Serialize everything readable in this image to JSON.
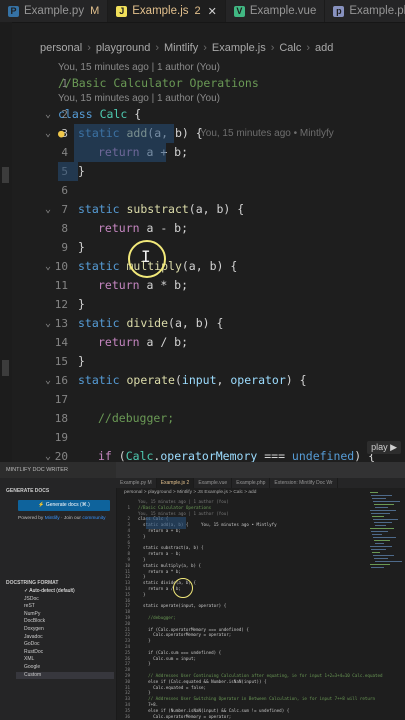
{
  "top_editor": {
    "tabs": [
      {
        "label": "Example.py",
        "badge": "M",
        "icon": "python-icon",
        "icon_color": "#3572A5"
      },
      {
        "label": "Example.js",
        "badge": "2",
        "icon": "javascript-icon",
        "icon_color": "#f1e05a",
        "active": true
      },
      {
        "label": "Example.vue",
        "badge": "",
        "icon": "vue-icon",
        "icon_color": "#41b883"
      },
      {
        "label": "Example.php",
        "badge": "",
        "icon": "php-icon",
        "icon_color": "#8892bf"
      }
    ],
    "breadcrumb": [
      "personal",
      "playground",
      "Mintlify",
      "Example.js",
      "Calc",
      "add"
    ],
    "author_notes": [
      "You, 15 minutes ago | 1 author (You)",
      "You, 15 minutes ago | 1 author (You)"
    ],
    "blame_inline": "You, 15 minutes ago • Mintlyfy",
    "lines": [
      {
        "n": "",
        "note": 0
      },
      {
        "n": "1",
        "text": "//Basic Calculator Operations"
      },
      {
        "n": "",
        "note": 1
      },
      {
        "n": "2",
        "text": "class Calc {"
      },
      {
        "n": "3",
        "text": "static add(a, b) {"
      },
      {
        "n": "4",
        "text": "return a + b;"
      },
      {
        "n": "5",
        "text": "}"
      },
      {
        "n": "6",
        "text": ""
      },
      {
        "n": "7",
        "text": "static substract(a, b) {"
      },
      {
        "n": "8",
        "text": "return a - b;"
      },
      {
        "n": "9",
        "text": "}"
      },
      {
        "n": "10",
        "text": "static multiply(a, b) {"
      },
      {
        "n": "11",
        "text": "return a * b;"
      },
      {
        "n": "12",
        "text": "}"
      },
      {
        "n": "13",
        "text": "static divide(a, b) {"
      },
      {
        "n": "14",
        "text": "return a / b;"
      },
      {
        "n": "15",
        "text": "}"
      },
      {
        "n": "16",
        "text": "static operate(input, operator) {"
      },
      {
        "n": "17",
        "text": ""
      },
      {
        "n": "18",
        "text": "//debugger;"
      },
      {
        "n": "19",
        "text": ""
      },
      {
        "n": "20",
        "text": "if (Calc.operatorMemory === undefined) {"
      },
      {
        "n": "21",
        "text": "Calc.operatorMemory = operator;"
      },
      {
        "n": "22",
        "text": "}"
      },
      {
        "n": "23",
        "text": ""
      },
      {
        "n": "24",
        "text": "if (Calc.sum === undefined) {"
      },
      {
        "n": "25",
        "text": "Calc.sum = input;"
      },
      {
        "n": "26",
        "text": ""
      },
      {
        "n": "27",
        "text": "}"
      },
      {
        "n": "28",
        "text": ""
      },
      {
        "n": "29",
        "text": "// Addresses User Continuing Calculation after equating, ie f"
      },
      {
        "n": "",
        "text": "14."
      },
      {
        "n": "30",
        "text": "else if (Calc.equated && Number.isNaN(input)) {"
      },
      {
        "n": "31",
        "text": "Calc.equated = false;"
      }
    ],
    "play_badge": "play ▶"
  },
  "bottom_window": {
    "sidebar_title": "MINTLIFY DOC WRITER",
    "generate_header": "GENERATE DOCS",
    "generate_button": "⚡ Generate docs (⌘.)",
    "powered_prefix": "Powered by",
    "powered_link1": "Mintlify",
    "powered_mid": "· Join our",
    "powered_link2": "community",
    "format_header": "DOCSTRING FORMAT",
    "formats": [
      "Auto-detect (default)",
      "JSDoc",
      "reST",
      "NumPy",
      "DocBlock",
      "Doxygen",
      "Javadoc",
      "GoDoc",
      "RustDoc",
      "XML",
      "Google",
      "Custom"
    ],
    "tabs": [
      "Example.py M",
      "Example.js 2",
      "Example.vue",
      "Example.php",
      "Extension: Mintlify Doc Wr"
    ],
    "breadcrumb": "personal > playground > Mintlify > JS Example.js > Calc > add",
    "code": [
      "You, 15 minutes ago | 1 author (You)",
      "//Basic Calculator Operations",
      "You, 15 minutes ago | 1 author (You)",
      "class Calc {",
      "  static add(a, b) {     You, 15 minutes ago • Mintlyfy",
      "    return a + b;",
      "  }",
      "",
      "  static substract(a, b) {",
      "    return a - b;",
      "  }",
      "  static multiply(a, b) {",
      "    return a * b;",
      "  }",
      "  static divide(a, b) {",
      "    return a / b;",
      "  }",
      "",
      "  static operate(input, operator) {",
      "",
      "    //debugger;",
      "",
      "    if (Calc.operatorMemory === undefined) {",
      "      Calc.operatorMemory = operator;",
      "    }",
      "",
      "    if (Calc.sum === undefined) {",
      "      Calc.sum = input;",
      "    }",
      "",
      "    // Addresses User Continuing Calculation after equating, ie for input 1+2=3+4=10 Calc.equated",
      "    else if (Calc.equated && Number.isNaN(input)) {",
      "      Calc.equated = false;",
      "    }",
      "    // Addresses User Switching Operator in Between Calculation, ie for input 7++8 will return",
      "    7+8.",
      "    else if (Number.isNaN(input) && Calc.sum != undefined) {",
      "      Calc.operatorMemory = operator;"
    ]
  }
}
